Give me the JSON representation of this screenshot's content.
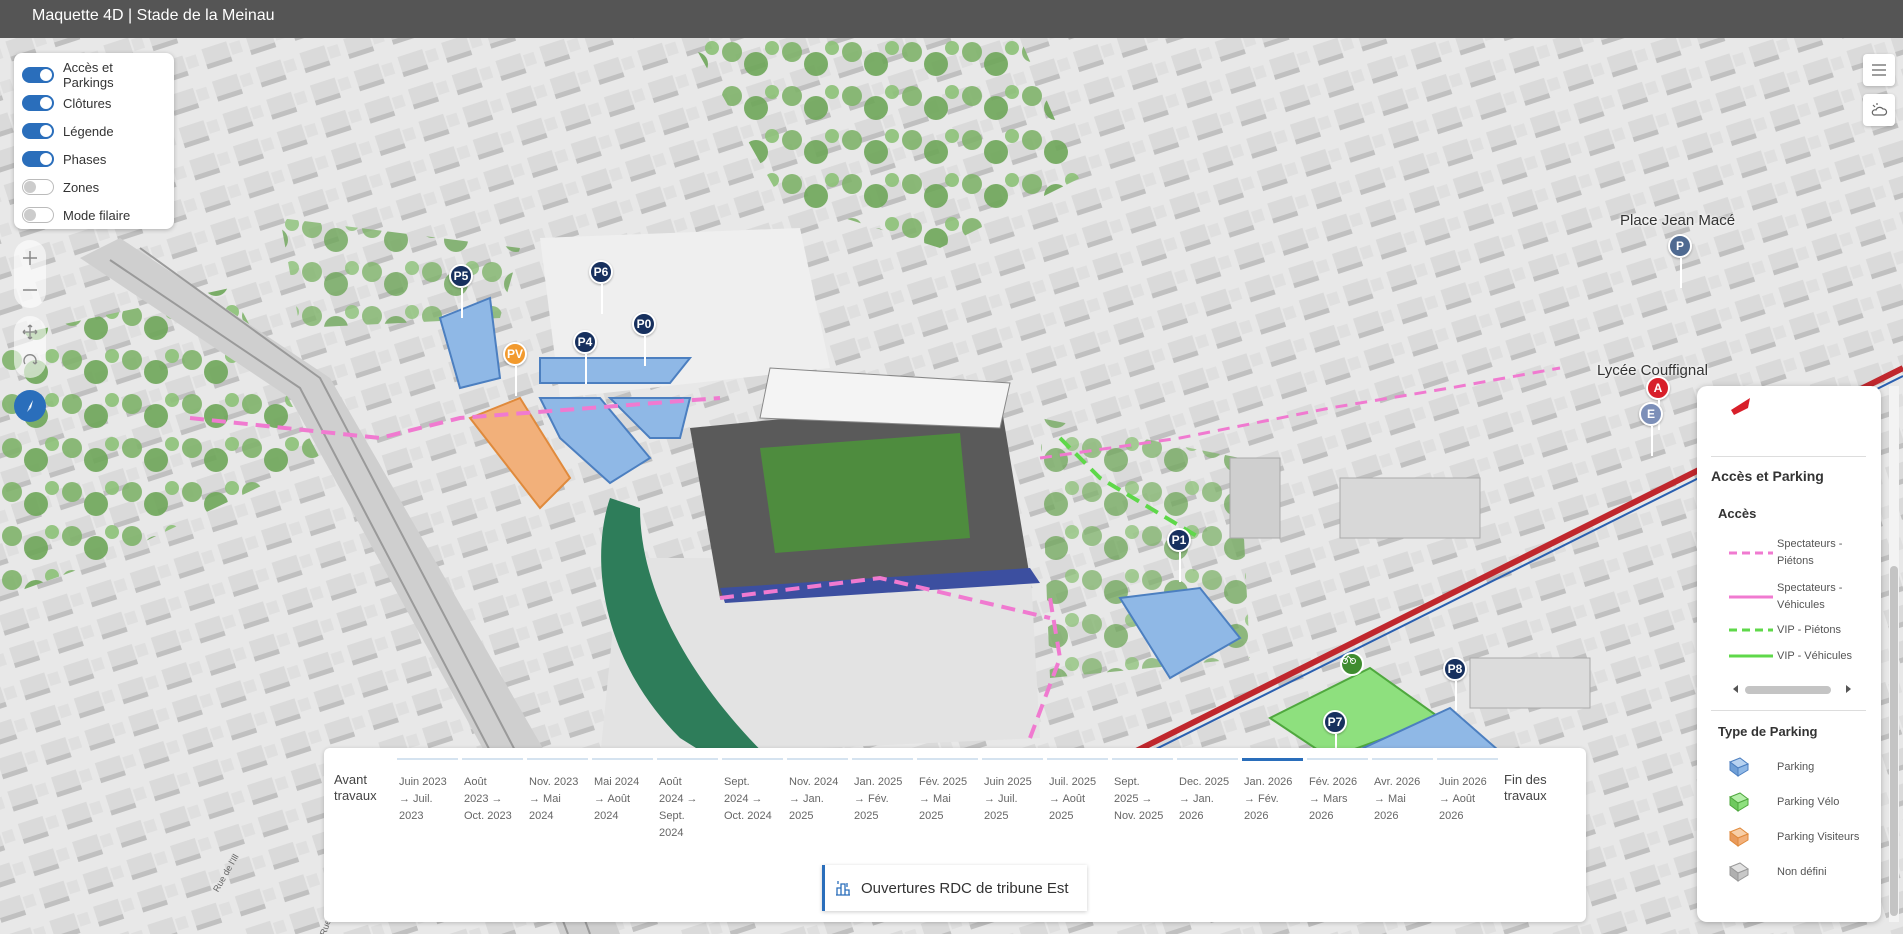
{
  "app": {
    "title": "Maquette 4D | Stade de la Meinau"
  },
  "layers": [
    {
      "label": "Accès et Parkings",
      "on": true
    },
    {
      "label": "Clôtures",
      "on": true
    },
    {
      "label": "Légende",
      "on": true
    },
    {
      "label": "Phases",
      "on": true
    },
    {
      "label": "Zones",
      "on": false
    },
    {
      "label": "Mode filaire",
      "on": false
    }
  ],
  "map_labels": {
    "place": "Place Jean Macé",
    "lycee": "Lycée Couffignal",
    "road1": "Rue de l'Ill",
    "road2": "Rue de Lembach"
  },
  "markers": {
    "p5": "P5",
    "p6": "P6",
    "p4": "P4",
    "p0": "P0",
    "pv": "PV",
    "p1": "P1",
    "p7": "P7",
    "p8": "P8",
    "place_p": "P",
    "a": "A",
    "e": "E"
  },
  "legend": {
    "section_title": "Accès et Parking",
    "acces_title": "Accès",
    "acces_items": [
      {
        "label": "Spectateurs - Piétons",
        "color": "#f07ad0",
        "dash": true
      },
      {
        "label": "Spectateurs - Véhicules",
        "color": "#f07ad0",
        "dash": false
      },
      {
        "label": "VIP - Piétons",
        "color": "#5fd84a",
        "dash": true
      },
      {
        "label": "VIP - Véhicules",
        "color": "#5fd84a",
        "dash": false
      }
    ],
    "parking_title": "Type de Parking",
    "parking_items": [
      {
        "label": "Parking",
        "color": "#8fb8e6"
      },
      {
        "label": "Parking Vélo",
        "color": "#8ee07e"
      },
      {
        "label": "Parking Visiteurs",
        "color": "#f2b07a"
      },
      {
        "label": "Non défini",
        "color": "#c8c8c8"
      }
    ]
  },
  "timeline": {
    "phases": [
      {
        "label": "Avant\ntravaux",
        "edge": true
      },
      {
        "label": "Juin 2023\n→ Juil.\n2023"
      },
      {
        "label": "Août\n2023 →\nOct. 2023"
      },
      {
        "label": "Nov. 2023\n→ Mai\n2024"
      },
      {
        "label": "Mai 2024\n→ Août\n2024"
      },
      {
        "label": "Août\n2024 →\nSept.\n2024"
      },
      {
        "label": "Sept.\n2024 →\nOct. 2024"
      },
      {
        "label": "Nov. 2024\n→ Jan.\n2025"
      },
      {
        "label": "Jan. 2025\n→ Fév.\n2025"
      },
      {
        "label": "Fév. 2025\n→ Mai\n2025"
      },
      {
        "label": "Juin 2025\n→ Juil.\n2025"
      },
      {
        "label": "Juil. 2025\n→ Août\n2025"
      },
      {
        "label": "Sept.\n2025 →\nNov. 2025"
      },
      {
        "label": "Dec. 2025\n→ Jan.\n2026"
      },
      {
        "label": "Jan. 2026\n→ Fév.\n2026",
        "active": true
      },
      {
        "label": "Fév. 2026\n→ Mars\n2026"
      },
      {
        "label": "Avr. 2026\n→ Mai\n2026"
      },
      {
        "label": "Juin 2026\n→ Août\n2026"
      },
      {
        "label": "Fin des\ntravaux",
        "edge": true
      }
    ],
    "event_label": "Ouvertures RDC de tribune Est"
  },
  "colors": {
    "accent": "#2a6ebb",
    "marker": "#17305e",
    "parking": "#8fb8e6",
    "visitor": "#f2b07a",
    "bike": "#8ee07e",
    "pedestrian": "#f07ad0"
  }
}
